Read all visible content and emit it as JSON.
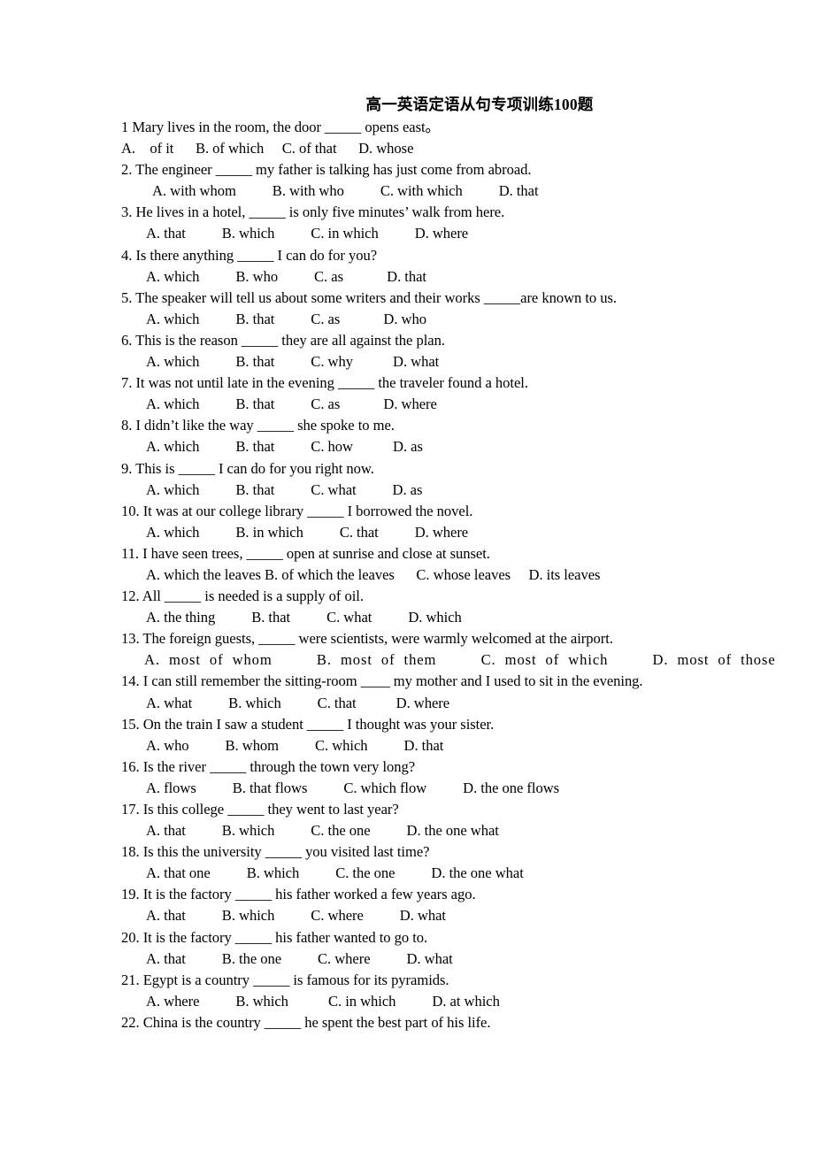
{
  "document": {
    "title": "高一英语定语从句专项训练100题",
    "questions": [
      {
        "stem": "1 Mary lives in the room, the door _____ opens east。",
        "options": "A.    of it      B. of which     C. of that      D. whose",
        "options_style": "flush"
      },
      {
        "stem": "2. The engineer _____ my father is talking has just come from abroad.",
        "options": "A. with whom          B. with who          C. with which          D. that",
        "options_style": "deep"
      },
      {
        "stem": "3. He lives in a hotel, _____ is only five minutes’ walk from here.",
        "options": "A. that          B. which          C. in which          D. where",
        "options_style": "normal"
      },
      {
        "stem": "4. Is there anything _____ I can do for you?",
        "options": "A. which          B. who          C. as            D. that",
        "options_style": "normal"
      },
      {
        "stem": "5. The speaker will tell us about some writers and their works _____are known to us.",
        "options": "A. which          B. that          C. as            D. who",
        "options_style": "normal"
      },
      {
        "stem": "6. This is the reason _____ they are all against the plan.",
        "options": "A. which          B. that          C. why           D. what",
        "options_style": "normal"
      },
      {
        "stem": "7. It was not until late in the evening _____ the traveler found a hotel.",
        "options": "A. which          B. that          C. as            D. where",
        "options_style": "normal"
      },
      {
        "stem": "8. I didn’t like the way _____ she spoke to me.",
        "options": "A. which          B. that          C. how           D. as",
        "options_style": "normal"
      },
      {
        "stem": "9. This is _____ I can do for you right now.",
        "options": "A. which          B. that          C. what          D. as",
        "options_style": "normal"
      },
      {
        "stem": "10. It was at our college library _____ I borrowed the novel.",
        "options": "A. which          B. in which          C. that          D. where",
        "options_style": "normal"
      },
      {
        "stem": "11. I have seen trees, _____ open at sunrise and close at sunset.",
        "options": "A. which the leaves B. of which the leaves      C. whose leaves     D. its leaves",
        "options_style": "normal"
      },
      {
        "stem": "12. All _____ is needed is a supply of oil.",
        "options": "A. the thing          B. that          C. what          D. which",
        "options_style": "normal"
      },
      {
        "stem": "13. The foreign guests, _____ were scientists, were warmly welcomed at the airport.",
        "options": "A. most of whom     B. most of them     C. most of which     D. most of those",
        "options_style": "wide"
      },
      {
        "stem": "14. I can still remember the sitting-room ____ my mother and I used to sit in the evening.",
        "options": "A. what          B. which          C. that           D. where",
        "options_style": "normal"
      },
      {
        "stem": "15. On the train I saw a student _____ I thought was your sister.",
        "options": "A. who          B. whom          C. which          D. that",
        "options_style": "normal"
      },
      {
        "stem": "16. Is the river _____ through the town very long?",
        "options": "A. flows          B. that flows          C. which flow          D. the one flows",
        "options_style": "normal"
      },
      {
        "stem": "17. Is this college _____ they went to last year?",
        "options": "A. that          B. which          C. the one          D. the one what",
        "options_style": "normal"
      },
      {
        "stem": "18. Is this the university _____ you visited last time?",
        "options": "A. that one          B. which          C. the one          D. the one what",
        "options_style": "normal"
      },
      {
        "stem": "19. It is the factory _____ his father worked a few years ago.",
        "options": "A. that          B. which          C. where          D. what",
        "options_style": "normal"
      },
      {
        "stem": "20. It is the factory _____ his father wanted to go to.",
        "options": "A. that          B. the one          C. where          D. what",
        "options_style": "normal"
      },
      {
        "stem": "21. Egypt is a country _____ is famous for its pyramids.",
        "options": "A. where          B. which           C. in which          D. at which",
        "options_style": "normal"
      },
      {
        "stem": "22. China is the country _____ he spent the best part of his life.",
        "options": null,
        "options_style": "normal"
      }
    ]
  }
}
